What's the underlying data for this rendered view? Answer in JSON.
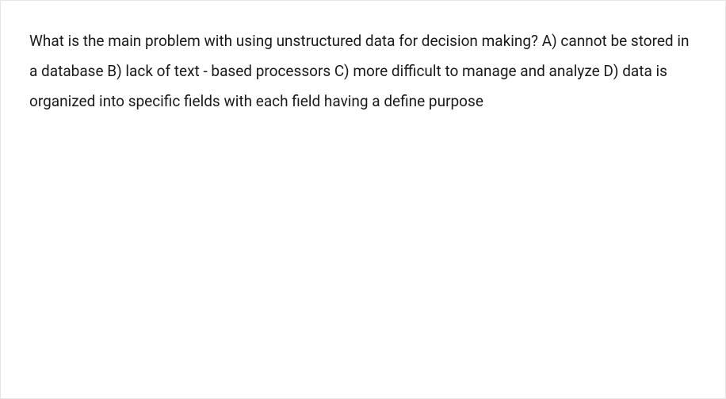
{
  "question": {
    "text": "What is the main problem with using unstructured data for decision making? A) cannot be stored in a database B) lack of text - based processors C) more difficult to manage and analyze D) data is organized into specific fields with each field having a define purpose"
  }
}
